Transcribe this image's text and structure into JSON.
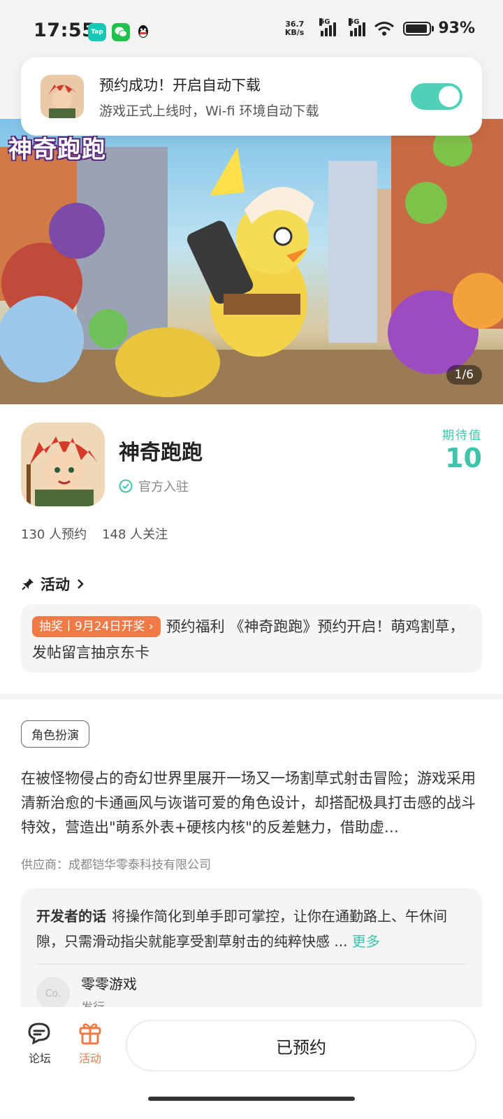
{
  "status_bar": {
    "time": "17:55",
    "net_speed_value": "36.7",
    "net_speed_unit": "KB/s",
    "signal_label_1": "5G",
    "signal_label_2": "5G",
    "battery_level": 0.93,
    "battery_text": "93%",
    "apps": [
      "tap-icon",
      "wechat-icon",
      "qq-icon"
    ],
    "tap_label": "Tap"
  },
  "toast": {
    "title": "预约成功！开启自动下载",
    "subtitle": "游戏正式上线时，Wi-fi 环境自动下载",
    "toggle_on": true
  },
  "hero": {
    "logo_text": "神奇跑跑",
    "pager": "1/6"
  },
  "game": {
    "name": "神奇跑跑",
    "official_label": "官方入驻",
    "expect_label": "期待值",
    "expect_value": "10",
    "stats": [
      "130 人预约",
      "148 人关注"
    ]
  },
  "activity": {
    "heading": "活动",
    "tag": "抽奖丨9月24日开奖",
    "text": "预约福利 《神奇跑跑》预约开启！萌鸡割草，发帖留言抽京东卡"
  },
  "description": {
    "genre": "角色扮演",
    "text": "在被怪物侵占的奇幻世界里展开一场又一场割草式射击冒险；游戏采用清新治愈的卡通画风与诙谐可爱的角色设计，却搭配极具打击感的战斗特效，营造出\"萌系外表+硬核内核\"的反差魅力，借助虚…",
    "supplier": "供应商：成都铠华零泰科技有限公司"
  },
  "developer": {
    "label": "开发者的话",
    "text": "将操作简化到单手即可掌控，让你在通勤路上、午休间隙，只需滑动指尖就能享受割草射击的纯粹快感 ...",
    "more": "更多",
    "publisher_avatar": "Co.",
    "publisher_name": "零零游戏",
    "publisher_role": "发行"
  },
  "bottom_bar": {
    "forum_label": "论坛",
    "activity_label": "活动",
    "reserve_label": "已预约"
  },
  "colors": {
    "accent": "#3fc3aa",
    "orange": "#f07a45"
  }
}
